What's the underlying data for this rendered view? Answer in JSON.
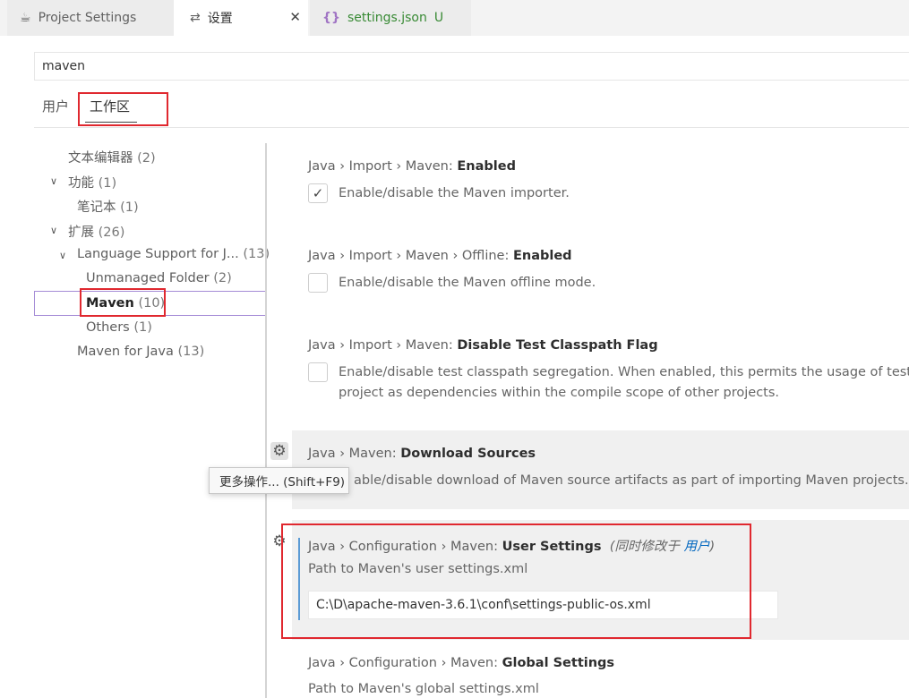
{
  "tabs": [
    {
      "label": "Project Settings",
      "icon": "coffee-cup-icon"
    },
    {
      "label": "设置",
      "icon": "settings-sliders-icon"
    },
    {
      "label": "settings.json",
      "icon": "json-braces-icon",
      "status": "U"
    }
  ],
  "search": {
    "value": "maven"
  },
  "scope_tabs": {
    "user": "用户",
    "workspace": "工作区"
  },
  "toc": [
    {
      "label": "文本编辑器",
      "count": "(2)"
    },
    {
      "label": "功能",
      "count": "(1)"
    },
    {
      "label": "笔记本",
      "count": "(1)"
    },
    {
      "label": "扩展",
      "count": "(26)"
    },
    {
      "label": "Language Support for J...",
      "count": "(13)"
    },
    {
      "label": "Unmanaged Folder",
      "count": "(2)"
    },
    {
      "label": "Maven",
      "count": "(10)"
    },
    {
      "label": "Others",
      "count": "(1)"
    },
    {
      "label": "Maven for Java",
      "count": "(13)"
    }
  ],
  "settings": [
    {
      "prefix": "Java › Import › Maven: ",
      "name": "Enabled",
      "desc": "Enable/disable the Maven importer.",
      "checked": true
    },
    {
      "prefix": "Java › Import › Maven › Offline: ",
      "name": "Enabled",
      "desc": "Enable/disable the Maven offline mode.",
      "checked": false
    },
    {
      "prefix": "Java › Import › Maven: ",
      "name": "Disable Test Classpath Flag",
      "desc_line1": "Enable/disable test classpath segregation. When enabled, this permits the usage of test re",
      "desc_line2": "project as dependencies within the compile scope of other projects.",
      "checked": false
    },
    {
      "prefix": "Java › Maven: ",
      "name": "Download Sources",
      "desc": "able/disable download of Maven source artifacts as part of importing Maven projects."
    },
    {
      "prefix": "Java › Configuration › Maven: ",
      "name": "User Settings",
      "also_prefix": "(同时修改于 ",
      "also_link": "用户",
      "also_suffix": ")",
      "desc": "Path to Maven's user settings.xml",
      "value": "C:\\D\\apache-maven-3.6.1\\conf\\settings-public-os.xml"
    },
    {
      "prefix": "Java › Configuration › Maven: ",
      "name": "Global Settings",
      "desc": "Path to Maven's global settings.xml"
    }
  ],
  "tooltip": {
    "text": "更多操作... (Shift+F9)"
  },
  "icons": {
    "gear": "gear-icon",
    "check": "checkmark-icon",
    "chevron": "chevron-down-icon",
    "close": "close-icon"
  },
  "colors": {
    "highlight_box": "#e0282f",
    "selected_outline": "#a58cd6",
    "modified_bar": "#5b9bd5",
    "json_tab_text": "#388a34"
  }
}
